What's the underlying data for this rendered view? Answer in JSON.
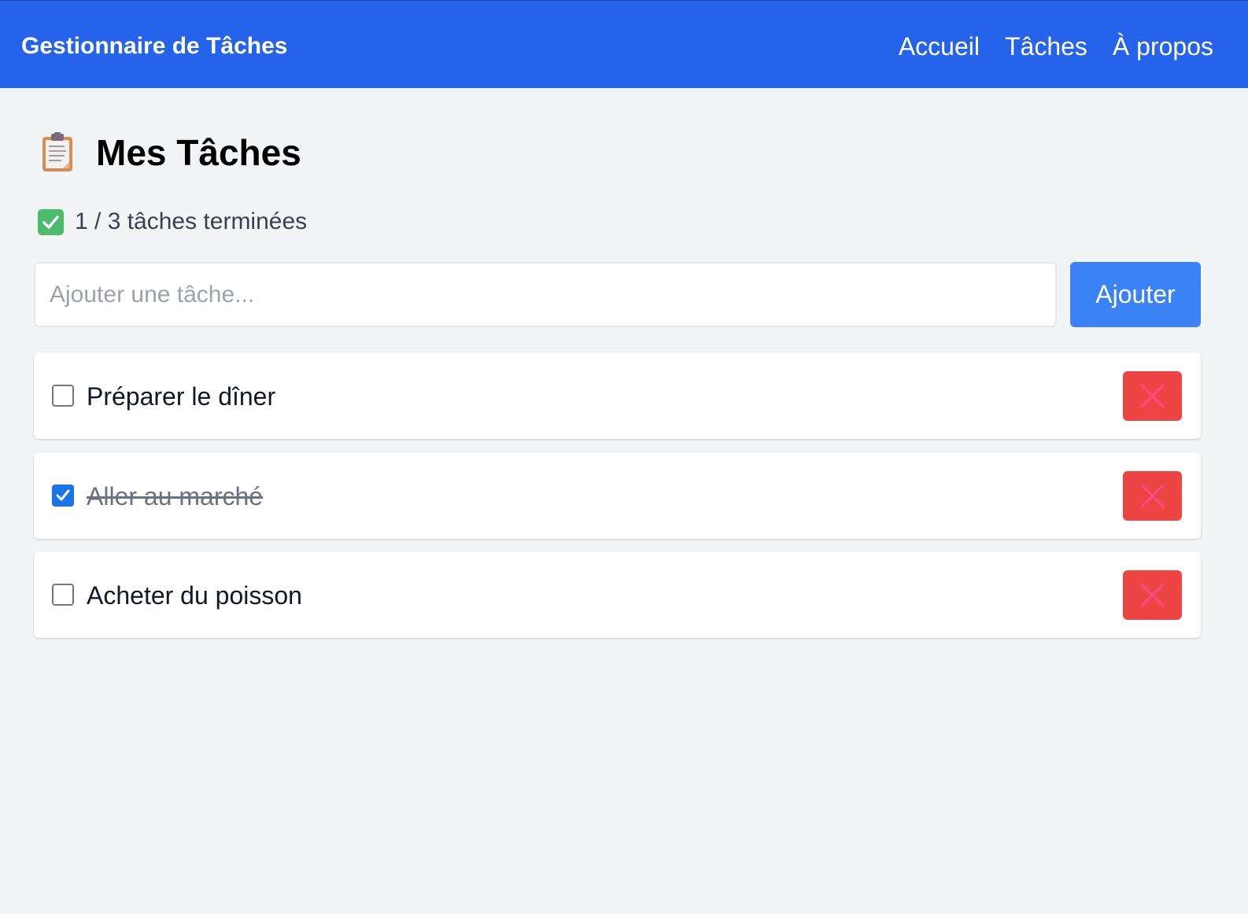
{
  "header": {
    "brand": "Gestionnaire de Tâches",
    "nav": [
      {
        "label": "Accueil"
      },
      {
        "label": "Tâches"
      },
      {
        "label": "À propos"
      }
    ]
  },
  "main": {
    "title_icon": "clipboard-icon",
    "title": "Mes Tâches",
    "counter_icon": "check-mark-button-icon",
    "counter_text": "1 / 3 tâches terminées",
    "input": {
      "value": "",
      "placeholder": "Ajouter une tâche..."
    },
    "add_label": "Ajouter",
    "tasks": [
      {
        "label": "Préparer le dîner",
        "done": false,
        "delete_icon": "close-icon"
      },
      {
        "label": "Aller au marché",
        "done": true,
        "delete_icon": "close-icon"
      },
      {
        "label": "Acheter du poisson",
        "done": false,
        "delete_icon": "close-icon"
      }
    ]
  },
  "colors": {
    "navbar": "#2563eb",
    "page_background": "#f3f4f6",
    "add_button": "#3b82f6",
    "delete_button": "#ef4444",
    "checkbox_checked": "#1a73e8"
  }
}
